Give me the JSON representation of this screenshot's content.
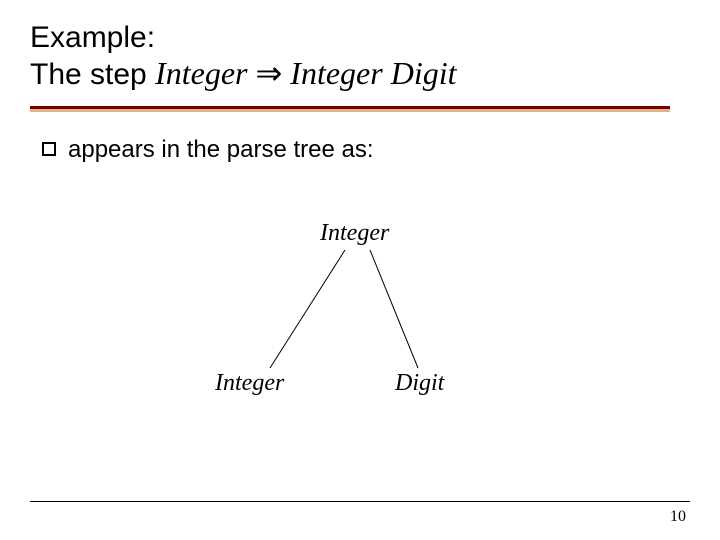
{
  "title": {
    "line1": "Example:",
    "line2_prefix": "The step ",
    "grammar_lhs": "Integer",
    "arrow": " ⇒ ",
    "grammar_rhs": "Integer Digit"
  },
  "bullet": {
    "text": "appears in the parse tree as:"
  },
  "tree": {
    "root": "Integer",
    "left": "Integer",
    "right": "Digit"
  },
  "page_number": "10"
}
